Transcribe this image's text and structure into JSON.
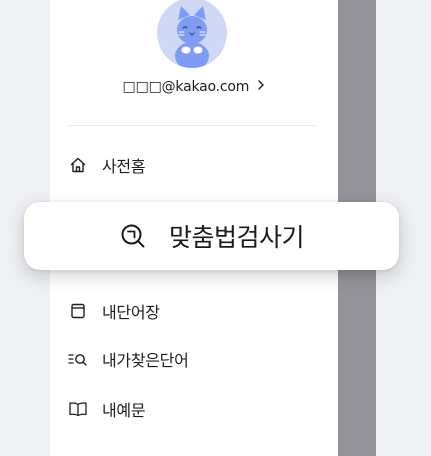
{
  "account": {
    "email": "□□□@kakao.com",
    "chevron_icon": "chevron-right-icon"
  },
  "menu": {
    "items": [
      {
        "id": "home",
        "label": "사전홈",
        "icon": "home-icon"
      },
      {
        "id": "my-words",
        "label": "내단어장",
        "icon": "notebook-icon"
      },
      {
        "id": "searched-words",
        "label": "내가찾은단어",
        "icon": "search-list-icon"
      },
      {
        "id": "my-examples",
        "label": "내예문",
        "icon": "book-icon"
      }
    ]
  },
  "popup": {
    "label": "맞춤법검사기",
    "icon": "spell-check-search-icon"
  },
  "colors": {
    "background": "#eef0f4",
    "panel": "#ffffff",
    "overlay_strip": "#949399",
    "avatar_bg": "#cfd9f6",
    "avatar_cat": "#7e9cf2",
    "text": "#1e1e1e"
  }
}
